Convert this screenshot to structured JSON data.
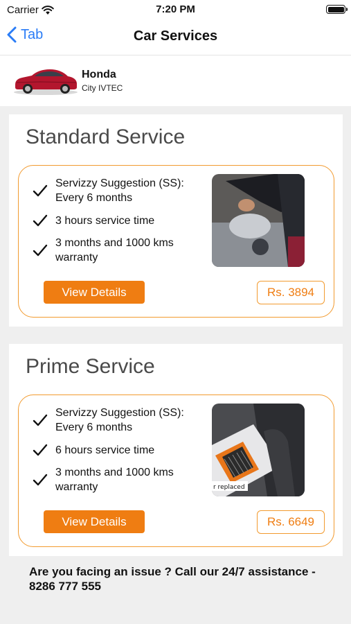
{
  "status_bar": {
    "carrier": "Carrier",
    "time": "7:20 PM",
    "icons": [
      "wifi-icon",
      "battery-icon"
    ]
  },
  "nav": {
    "back_label": "Tab",
    "title": "Car Services",
    "back_icon": "chevron-left-icon"
  },
  "car": {
    "make": "Honda",
    "model": "City IVTEC"
  },
  "services": [
    {
      "title": "Standard Service",
      "features": [
        "Servizzy Suggestion (SS): Every 6 months",
        "3 hours service time",
        "3 months and 1000 kms warranty"
      ],
      "button_label": "View Details",
      "price": "Rs. 3894"
    },
    {
      "title": "Prime Service",
      "features": [
        "Servizzy Suggestion (SS): Every 6 months",
        "6 hours service time",
        "3 months and 1000 kms warranty"
      ],
      "button_label": "View Details",
      "price": "Rs. 6649",
      "photo_caption": "r replaced"
    }
  ],
  "footer": {
    "text": "Are you facing an issue ? Call our 24/7 assistance - 8286 777 555"
  },
  "colors": {
    "accent": "#ef7d12",
    "card_border": "#f29a2e",
    "link": "#2a7cf6",
    "background": "#efefef"
  }
}
